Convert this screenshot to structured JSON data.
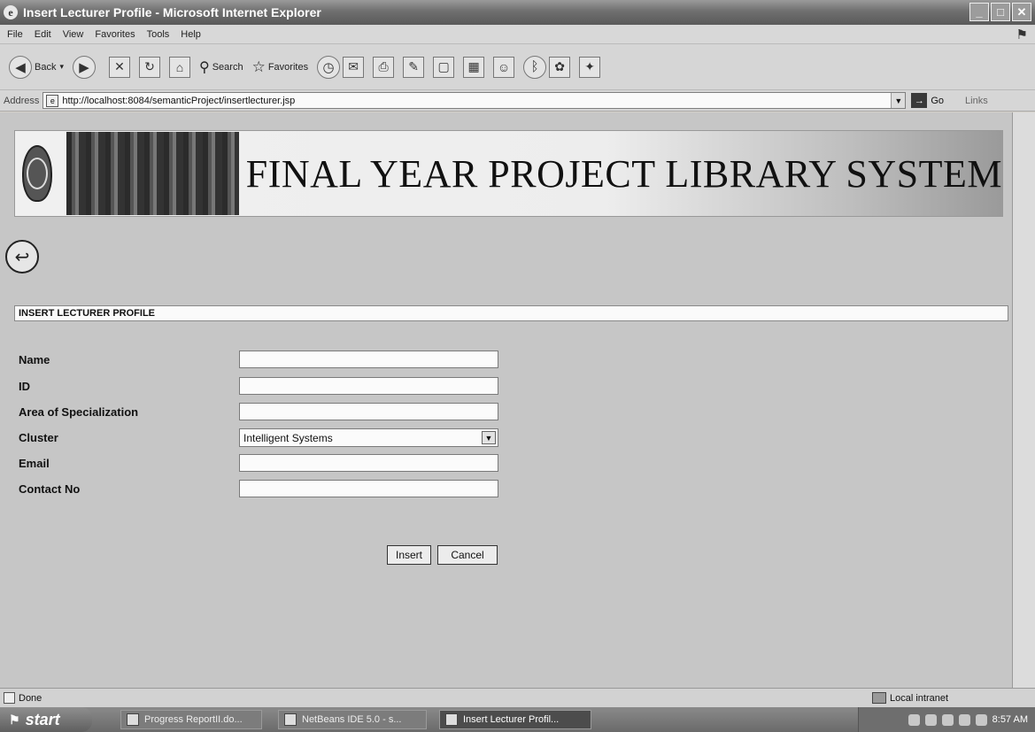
{
  "window": {
    "title": "Insert Lecturer Profile - Microsoft Internet Explorer",
    "controls": [
      "_",
      "□",
      "✕"
    ]
  },
  "menu": {
    "items": [
      "File",
      "Edit",
      "View",
      "Favorites",
      "Tools",
      "Help"
    ]
  },
  "toolbar": {
    "back_label": "Back",
    "search_label": "Search",
    "favorites_label": "Favorites"
  },
  "address": {
    "label": "Address",
    "url": "http://localhost:8084/semanticProject/insertlecturer.jsp",
    "go_label": "Go",
    "links_label": "Links"
  },
  "banner": {
    "title": "FINAL YEAR PROJECT LIBRARY SYSTEM"
  },
  "form": {
    "header": "INSERT LECTURER PROFILE",
    "fields": {
      "name_label": "Name",
      "id_label": "ID",
      "area_label": "Area of Specialization",
      "cluster_label": "Cluster",
      "email_label": "Email",
      "contact_label": "Contact No"
    },
    "cluster_value": "Intelligent Systems",
    "insert_label": "Insert",
    "cancel_label": "Cancel"
  },
  "status": {
    "left": "Done",
    "zone": "Local intranet"
  },
  "taskbar": {
    "start_label": "start",
    "tasks": [
      "Progress ReportII.do...",
      "NetBeans IDE 5.0 - s...",
      "Insert Lecturer Profil..."
    ],
    "clock": "8:57 AM"
  },
  "colors": {
    "page_background": "#c6c6c6",
    "title_bar": "#6f6f6f"
  }
}
